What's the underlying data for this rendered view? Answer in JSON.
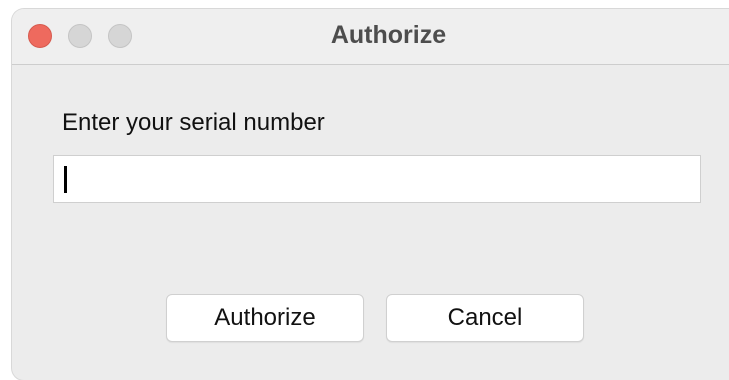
{
  "window": {
    "title": "Authorize",
    "controls": {
      "close": "close-button",
      "minimize": "minimize-button",
      "zoom": "zoom-button"
    }
  },
  "form": {
    "prompt_label": "Enter your serial number",
    "serial_value": "",
    "serial_placeholder": ""
  },
  "buttons": {
    "authorize_label": "Authorize",
    "cancel_label": "Cancel"
  },
  "colors": {
    "close": "#ee6a5e",
    "inactive_control": "#d6d6d6",
    "window_bg": "#ececec"
  }
}
